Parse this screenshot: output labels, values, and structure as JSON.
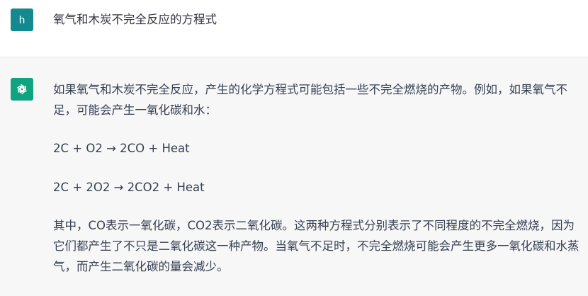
{
  "user": {
    "avatar_letter": "h",
    "message": "氧气和木炭不完全反应的方程式"
  },
  "assistant": {
    "avatar_icon": "openai-logo-icon",
    "paragraph_1": "如果氧气和木炭不完全反应，产生的化学方程式可能包括一些不完全燃烧的产物。例如，如果氧气不足，可能会产生一氧化碳和水：",
    "equation_1": "2C + O2 → 2CO + Heat",
    "equation_2": "2C + 2O2 → 2CO2 + Heat",
    "paragraph_2": "其中，CO表示一氧化碳，CO2表示二氧化碳。这两种方程式分别表示了不同程度的不完全燃烧，因为它们都产生了不只是二氧化碳这一种产物。当氧气不足时，不完全燃烧可能会产生更多一氧化碳和水蒸气，而产生二氧化碳的量会减少。"
  },
  "colors": {
    "user_avatar_bg": "#128a8f",
    "assistant_avatar_bg": "#10a37f",
    "assistant_row_bg": "#f7f7f8",
    "text": "#374151"
  }
}
